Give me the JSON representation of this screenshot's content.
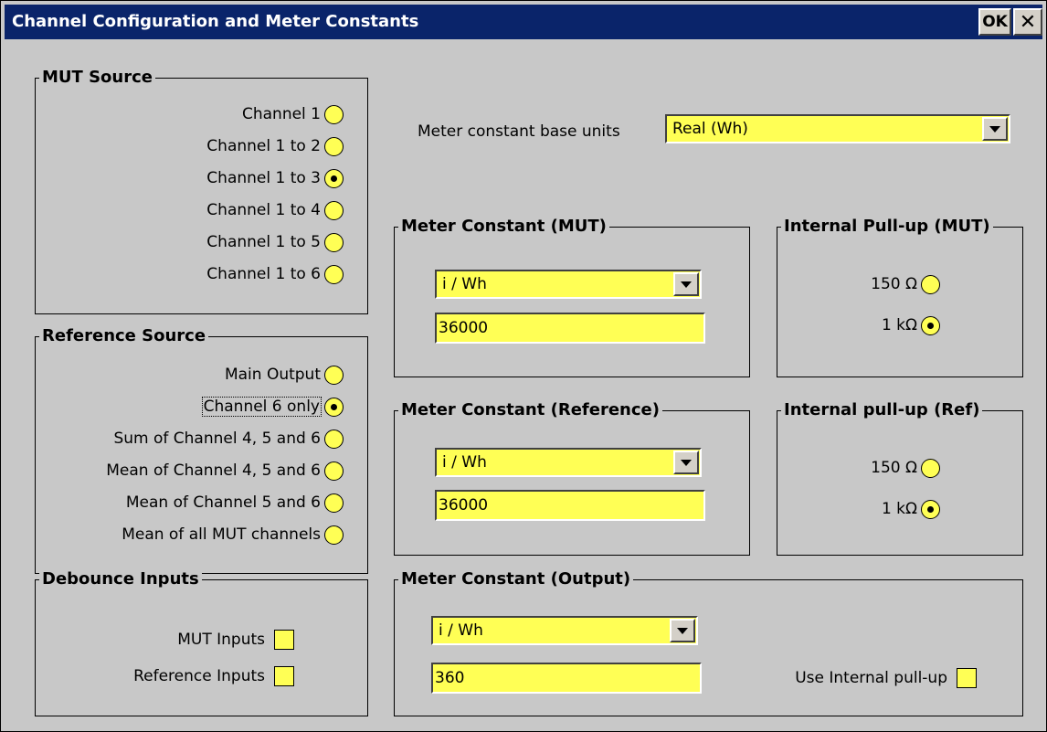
{
  "window": {
    "title": "Channel Configuration and Meter Constants",
    "ok_label": "OK",
    "close_label": "✕"
  },
  "mut_source": {
    "title": "MUT Source",
    "options": [
      {
        "label": "Channel 1",
        "checked": false
      },
      {
        "label": "Channel 1 to 2",
        "checked": false
      },
      {
        "label": "Channel 1 to 3",
        "checked": true
      },
      {
        "label": "Channel 1 to 4",
        "checked": false
      },
      {
        "label": "Channel 1 to 5",
        "checked": false
      },
      {
        "label": "Channel 1 to 6",
        "checked": false
      }
    ]
  },
  "reference_source": {
    "title": "Reference Source",
    "options": [
      {
        "label": "Main Output",
        "checked": false
      },
      {
        "label": "Channel 6 only",
        "checked": true
      },
      {
        "label": "Sum of Channel 4, 5 and 6",
        "checked": false
      },
      {
        "label": "Mean of Channel 4, 5 and 6",
        "checked": false
      },
      {
        "label": "Mean of Channel 5 and 6",
        "checked": false
      },
      {
        "label": "Mean of all MUT channels",
        "checked": false
      }
    ]
  },
  "debounce": {
    "title": "Debounce Inputs",
    "mut_label": "MUT Inputs",
    "ref_label": "Reference Inputs"
  },
  "base_units": {
    "label": "Meter constant base units",
    "value": "Real (Wh)"
  },
  "mc_mut": {
    "title": "Meter Constant (MUT)",
    "unit": "i / Wh",
    "value": "36000"
  },
  "pullup_mut": {
    "title": "Internal Pull-up (MUT)",
    "opt1": "150 Ω",
    "opt2": "1 kΩ",
    "selected": "1 kΩ"
  },
  "mc_ref": {
    "title": "Meter Constant (Reference)",
    "unit": "i / Wh",
    "value": "36000"
  },
  "pullup_ref": {
    "title": "Internal pull-up (Ref)",
    "opt1": "150 Ω",
    "opt2": "1 kΩ",
    "selected": "1 kΩ"
  },
  "mc_out": {
    "title": "Meter Constant (Output)",
    "unit": "i / Wh",
    "value": "360",
    "pullup_label": "Use Internal pull-up"
  },
  "colors": {
    "field_yellow": "#ffff55",
    "titlebar": "#0a246a",
    "background": "#c8c8c8"
  }
}
